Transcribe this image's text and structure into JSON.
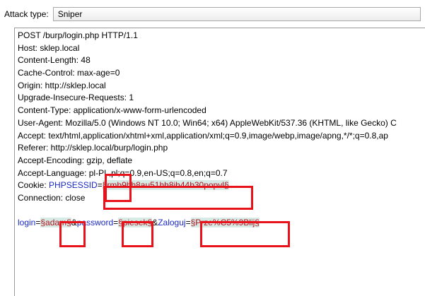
{
  "attack_type": {
    "label": "Attack type:",
    "selected": "Sniper"
  },
  "request": {
    "lines": [
      "POST /burp/login.php HTTP/1.1",
      "Host: sklep.local",
      "Content-Length: 48",
      "Cache-Control: max-age=0",
      "Origin: http://sklep.local",
      "Upgrade-Insecure-Requests: 1",
      "Content-Type: application/x-www-form-urlencoded",
      "User-Agent: Mozilla/5.0 (Windows NT 10.0; Win64; x64) AppleWebKit/537.36 (KHTML, like Gecko) C",
      "Accept: text/html,application/xhtml+xml,application/xml;q=0.9,image/webp,image/apng,*/*;q=0.8,ap",
      "Referer: http://sklep.local/burp/login.php",
      "Accept-Encoding: gzip, deflate",
      "Accept-Language: pl-PL,pl;q=0.9,en-US;q=0.8,en;q=0.7"
    ],
    "cookie": {
      "prefix": "Cookie: ",
      "name": "PHPSESSID",
      "eq": "=",
      "value": "§rmb9bh8au51hh8ih44b30popvl§"
    },
    "connection": "Connection: close",
    "body": {
      "p1_name": "login",
      "p1_value": "§adam§",
      "amp1": "&",
      "p2_name": "password",
      "p2_value": "§piesek§",
      "amp2": "&",
      "p3_name": "Zaloguj",
      "p3_value": "§Prze%C5%9Blij§",
      "eq": "="
    }
  }
}
